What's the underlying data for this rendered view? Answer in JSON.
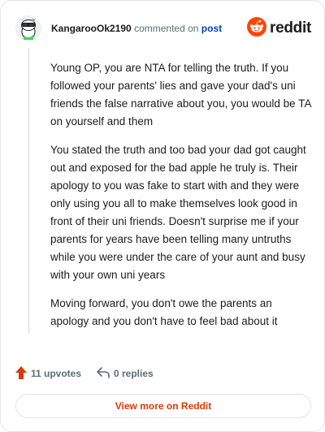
{
  "header": {
    "username": "KangarooOk2190",
    "action_text": "commented on",
    "post_link": "post",
    "brand": "reddit"
  },
  "comment": {
    "paragraphs": [
      "Young OP, you are NTA for telling the truth. If you followed your parents' lies and gave your dad's uni friends the false narrative about you, you would be TA on yourself and them",
      "You stated the truth and too bad your dad got caught out and exposed for the bad apple he truly is. Their apology to you was fake to start with and they were only using you all to make themselves look good in front of their uni friends. Doesn't surprise me if your parents for years have been telling many untruths while you were under the care of your aunt and busy with your own uni years",
      "Moving forward, you don't owe the parents an apology and you don't have to feel bad about it"
    ]
  },
  "footer": {
    "upvotes": "11 upvotes",
    "replies": "0 replies",
    "cta": "View more on Reddit"
  },
  "colors": {
    "brand_orange": "#ff4500",
    "upvote_orange": "#d93a00",
    "link_blue": "#0045ac",
    "muted": "#576f76"
  },
  "icons": {
    "avatar": "snoo-avatar-icon",
    "logo": "reddit-logo-icon",
    "upvote": "upvote-arrow-icon",
    "reply": "reply-arrow-icon"
  }
}
